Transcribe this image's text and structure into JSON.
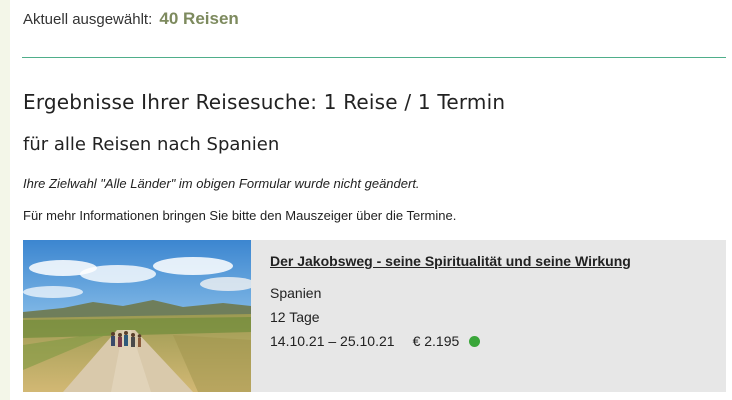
{
  "selection": {
    "label": "Aktuell ausgewählt:",
    "count": "40 Reisen"
  },
  "results": {
    "heading": "Ergebnisse Ihrer Reisesuche: 1 Reise / 1 Termin",
    "subheading": "für alle Reisen nach Spanien",
    "note": "Ihre Zielwahl \"Alle Länder\" im obigen Formular wurde nicht geändert.",
    "info": "Für mehr Informationen bringen Sie bitte den Mauszeiger über die Termine."
  },
  "trip": {
    "title": "Der Jakobsweg - seine Spiritualität und seine Wirkung",
    "country": "Spanien",
    "duration": "12 Tage",
    "dates": "14.10.21 – 25.10.21",
    "price": "€ 2.195",
    "status_color": "#3aa63a",
    "image_icon": "camino-path-photo"
  },
  "colors": {
    "accent_green": "#4fae8a",
    "selected_count": "#7d8a5e",
    "card_background": "#e7e7e7"
  }
}
